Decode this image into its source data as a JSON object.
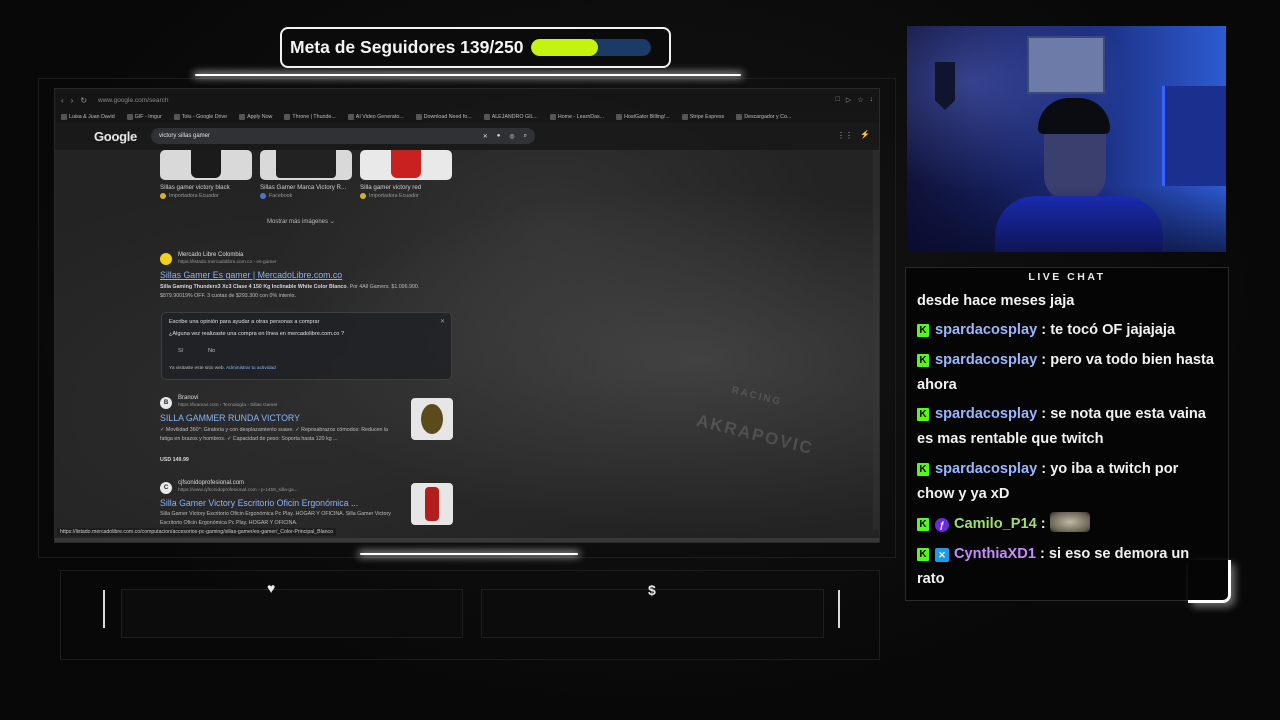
{
  "goal": {
    "text": "Meta de Seguidores 139/250",
    "current": 139,
    "target": 250,
    "progress": 0.556,
    "fill_color": "#c6f210",
    "track_color": "#1b3a66"
  },
  "browser": {
    "url": "www.google.com/search",
    "bookmarks": [
      "Luisa & Juan David",
      "GIF - Imgur",
      "Tolu - Google Drive",
      "Apply Now",
      "Throne | Thunde...",
      "AI Video Generato...",
      "Download Need fo...",
      "ALEJANDRO GIL...",
      "Home - LearnDas...",
      "HostGator Billing!...",
      "Stripe Express",
      "Descargador y Co..."
    ],
    "search_logo": "Google",
    "search_query": "victory sillas gamer",
    "images": [
      {
        "caption": "Sillas gamer victory black",
        "source": "Importadora Ecuador"
      },
      {
        "caption": "Sillas Gamer Marca Victory R...",
        "source": "Facebook"
      },
      {
        "caption": "Silla gamer victory red",
        "source": "Importadora Ecuador"
      }
    ],
    "more_images": "Mostrar más imágenes",
    "results": [
      {
        "site": "Mercado Libre Colombia",
        "url": "https://listado.mercadolibre.com.co › es-gamer",
        "title": "Sillas Gamer Es gamer | MercadoLibre.com.co",
        "snippet_bold": "Silla Gaming Thunderx3 Xc3 Clase 4 150 Kg Inclinable White Color Blanco",
        "snippet": ". Por 4All Gamers. $1.096.900. $879.90019% OFF. 3 cuotas de $293.300 con 0% interés."
      },
      {
        "site": "Branovi",
        "url": "https://branovi.com › Tecnología › Sillas Gamer",
        "title": "SILLA GAMMER RUNDA VICTORY",
        "snippet": "✓ Movilidad 360°: Giratoria y con desplazamiento suave. ✓ Reposabrazos cómodos: Reducen la fatiga en brazos y hombros. ✓ Capacidad de peso: Soporta hasta 120 kg ...",
        "price": "USD 149.99"
      },
      {
        "site": "cjfsonidoprofesional.com",
        "url": "https://www.cjfsonidoprofesional.com › p-1459_silla-ga...",
        "title": "Silla Gamer Victory Escritorio Oficin Ergonómica ...",
        "snippet": "Silla Gamer Victory Escritorio Oficin Ergonómica Pc Play. HOGAR Y OFICINA. Silla Gamer Victory Escritorio Oficin Ergonómica Pc Play. HOGAR Y OFICINA."
      }
    ],
    "feedback": {
      "line1": "Escribe una opinión para ayudar a otras personas a comprar",
      "question": "¿Alguna vez realizaste una compra en línea en mercadolibre.com.co ?",
      "yes": "Sí",
      "no": "No",
      "footer": "Ya visitaste este sitio web.",
      "footer_link": "Administrar tu actividad"
    },
    "status_url": "https://listado.mercadolibre.com.co/computacion/accesorios-pc-gaming/sillas-gamer/es-gamer/_Color-Principal_Blanco",
    "background_words": [
      "RACING",
      "AKRAPOVIC"
    ]
  },
  "panels": {
    "left_icon": "heart-icon",
    "right_icon": "dollar-icon",
    "left_glyph": "♥",
    "right_glyph": "$"
  },
  "chat": {
    "title": "LIVE CHAT",
    "messages": [
      {
        "user": "",
        "text": "desde hace meses jaja",
        "badges": []
      },
      {
        "user": "spardacosplay",
        "text": " : te tocó OF jajajaja",
        "badges": [
          "K"
        ]
      },
      {
        "user": "spardacosplay",
        "text": " : pero va todo bien hasta ahora",
        "badges": [
          "K"
        ]
      },
      {
        "user": "spardacosplay",
        "text": " : se nota que esta vaina es mas rentable que twitch",
        "badges": [
          "K"
        ]
      },
      {
        "user": "spardacosplay",
        "text": " : yo iba a twitch por chow y ya xD",
        "badges": [
          "K"
        ]
      },
      {
        "user": "Camilo_P14",
        "text": " : ",
        "badges": [
          "K",
          "P"
        ]
      },
      {
        "user": "CynthiaXD1",
        "text": " : si eso se demora un rato",
        "badges": [
          "K",
          "B"
        ]
      }
    ],
    "colors": {
      "blue": "#9ab6ff",
      "green": "#9dde70",
      "purple": "#c58bff",
      "kick": "#53fc18"
    }
  }
}
